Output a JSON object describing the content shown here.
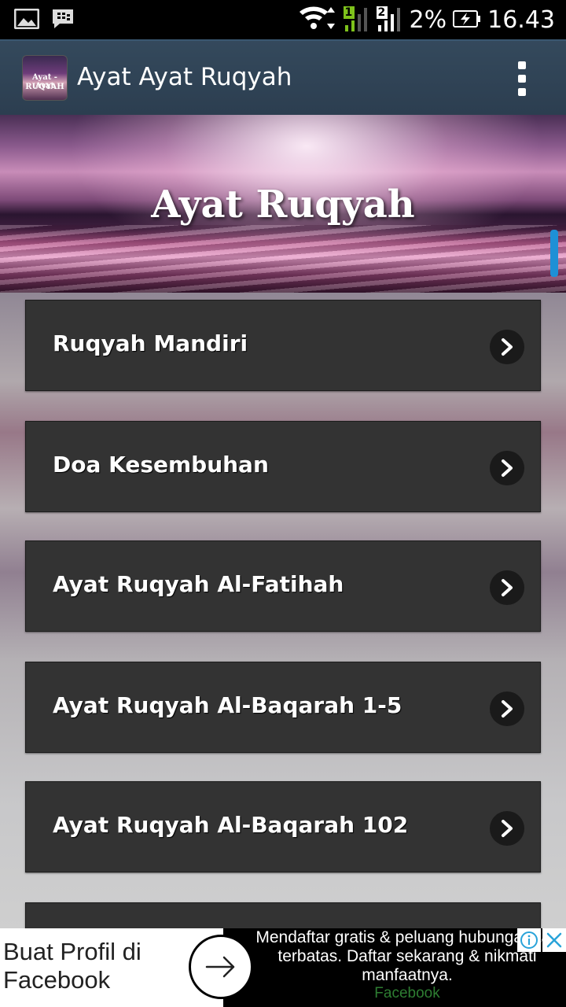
{
  "status_bar": {
    "left_icons": [
      "gallery-notification-icon",
      "bbm-notification-icon"
    ],
    "wifi_icon": "wifi-icon",
    "sim1_label": "1",
    "sim2_label": "2",
    "battery_percent": "2%",
    "battery_icon": "battery-charging-icon",
    "time": "16.43"
  },
  "app_bar": {
    "icon_text_top": "Ayat - Ayat",
    "icon_text_bottom": "RUQYAH",
    "title": "Ayat Ayat Ruqyah",
    "overflow_icon": "more-vertical-icon"
  },
  "banner": {
    "title": "Ayat Ruqyah"
  },
  "menu": {
    "items": [
      {
        "label": "Ruqyah Mandiri"
      },
      {
        "label": "Doa Kesembuhan"
      },
      {
        "label": "Ayat Ruqyah Al-Fatihah"
      },
      {
        "label": "Ayat Ruqyah Al-Baqarah 1-5"
      },
      {
        "label": "Ayat Ruqyah Al-Baqarah 102"
      },
      {
        "label": ""
      }
    ],
    "chevron_icon": "chevron-right-icon"
  },
  "ad": {
    "headline": "Buat Profil di Facebook",
    "body": "Mendaftar gratis & peluang hubungan tak terbatas. Daftar sekarang & nikmati manfaatnya.",
    "advertiser": "Facebook",
    "info_icon": "info-icon",
    "close_icon": "close-icon",
    "colors": {
      "advertiser": "#2e7d32"
    }
  },
  "colors": {
    "app_bar": "#2c3e50",
    "menu_item": "#333333",
    "scroll_indicator": "#1e90d6"
  }
}
